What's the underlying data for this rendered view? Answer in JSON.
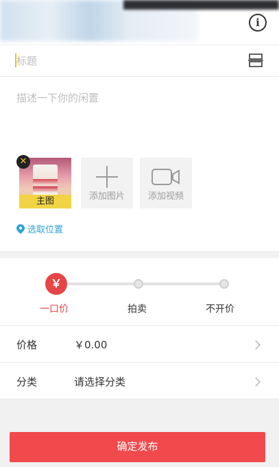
{
  "header": {
    "info_icon": "info-icon"
  },
  "form": {
    "title_placeholder": "标题",
    "description_placeholder": "描述一下你的闲置",
    "main_image_label": "主图",
    "add_photo_label": "添加图片",
    "add_video_label": "添加视频",
    "location_label": "选取位置"
  },
  "price_type": {
    "active_symbol": "￥",
    "options": [
      {
        "label": "一口价",
        "selected": true
      },
      {
        "label": "拍卖",
        "selected": false
      },
      {
        "label": "不开价",
        "selected": false
      }
    ]
  },
  "rows": {
    "price_label": "价格",
    "price_value": "￥0.00",
    "category_label": "分类",
    "category_value": "请选择分类"
  },
  "actions": {
    "publish_label": "确定发布"
  },
  "colors": {
    "accent_red": "#f24a4c",
    "link_blue": "#2ea3d6",
    "cursor_yellow": "#f5c400"
  }
}
